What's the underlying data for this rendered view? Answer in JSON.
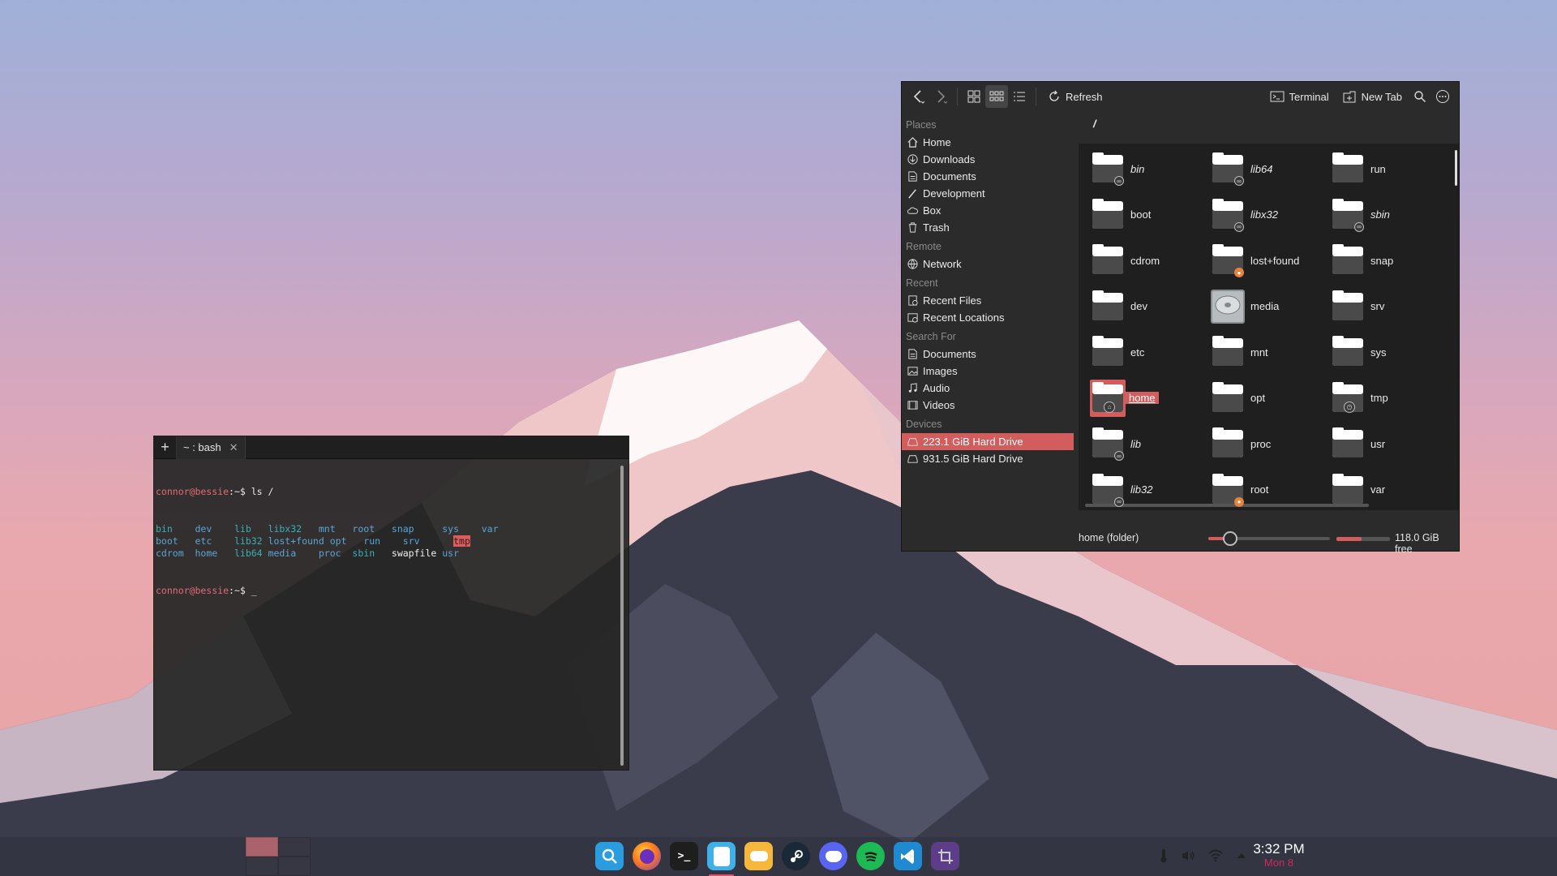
{
  "terminal": {
    "tab_title": "~ : bash",
    "prompt_user": "connor@bessie",
    "prompt_suffix": ":~$",
    "command": " ls /",
    "ls_rows": [
      [
        "bin",
        "dev",
        "lib",
        "libx32",
        "mnt",
        "root",
        "snap",
        "sys",
        "var"
      ],
      [
        "boot",
        "etc",
        "lib32",
        "lost+found",
        "opt",
        "run",
        "srv",
        "tmp",
        ""
      ],
      [
        "cdrom",
        "home",
        "lib64",
        "media",
        "proc",
        "sbin",
        "swapfile",
        "usr",
        ""
      ]
    ],
    "cursor": "_"
  },
  "file_manager": {
    "toolbar": {
      "refresh_label": "Refresh",
      "terminal_label": "Terminal",
      "new_tab_label": "New Tab"
    },
    "sidebar": {
      "places_heading": "Places",
      "places": [
        "Home",
        "Downloads",
        "Documents",
        "Development",
        "Box",
        "Trash"
      ],
      "remote_heading": "Remote",
      "remote": [
        "Network"
      ],
      "recent_heading": "Recent",
      "recent": [
        "Recent Files",
        "Recent Locations"
      ],
      "search_heading": "Search For",
      "search": [
        "Documents",
        "Images",
        "Audio",
        "Videos"
      ],
      "devices_heading": "Devices",
      "devices": [
        "223.1 GiB Hard Drive",
        "931.5 GiB Hard Drive"
      ]
    },
    "path": "/",
    "items": [
      {
        "name": "bin",
        "italic": true,
        "badge": "link"
      },
      {
        "name": "boot",
        "italic": false,
        "badge": ""
      },
      {
        "name": "cdrom",
        "italic": false,
        "badge": ""
      },
      {
        "name": "dev",
        "italic": false,
        "badge": ""
      },
      {
        "name": "etc",
        "italic": false,
        "badge": ""
      },
      {
        "name": "home",
        "italic": false,
        "badge": "home",
        "selected": true
      },
      {
        "name": "lib",
        "italic": true,
        "badge": "link"
      },
      {
        "name": "lib32",
        "italic": true,
        "badge": "link"
      },
      {
        "name": "lib64",
        "italic": true,
        "badge": "link"
      },
      {
        "name": "libx32",
        "italic": true,
        "badge": "link"
      },
      {
        "name": "lost+found",
        "italic": false,
        "badge": "lock"
      },
      {
        "name": "media",
        "italic": false,
        "badge": "drive"
      },
      {
        "name": "mnt",
        "italic": false,
        "badge": ""
      },
      {
        "name": "opt",
        "italic": false,
        "badge": ""
      },
      {
        "name": "proc",
        "italic": false,
        "badge": ""
      },
      {
        "name": "root",
        "italic": false,
        "badge": "lock"
      },
      {
        "name": "run",
        "italic": false,
        "badge": ""
      },
      {
        "name": "sbin",
        "italic": true,
        "badge": "link"
      },
      {
        "name": "snap",
        "italic": false,
        "badge": ""
      },
      {
        "name": "srv",
        "italic": false,
        "badge": ""
      },
      {
        "name": "sys",
        "italic": false,
        "badge": ""
      },
      {
        "name": "tmp",
        "italic": false,
        "badge": "clock"
      },
      {
        "name": "usr",
        "italic": false,
        "badge": ""
      },
      {
        "name": "var",
        "italic": false,
        "badge": ""
      }
    ],
    "status": {
      "selection": "home (folder)",
      "free_space": "118.0 GiB free",
      "zoom_level": 0.18,
      "disk_used_fraction": 0.47
    }
  },
  "taskbar": {
    "time": "3:32 PM",
    "date": "Mon 8",
    "apps": [
      "search-app",
      "firefox",
      "terminal",
      "files",
      "games",
      "steam",
      "discord",
      "spotify",
      "vscode",
      "screenshot"
    ]
  },
  "colors": {
    "accent": "#d35d5d",
    "panel_bg": "#2b2b2b",
    "grid_bg": "#1f1f1f"
  }
}
